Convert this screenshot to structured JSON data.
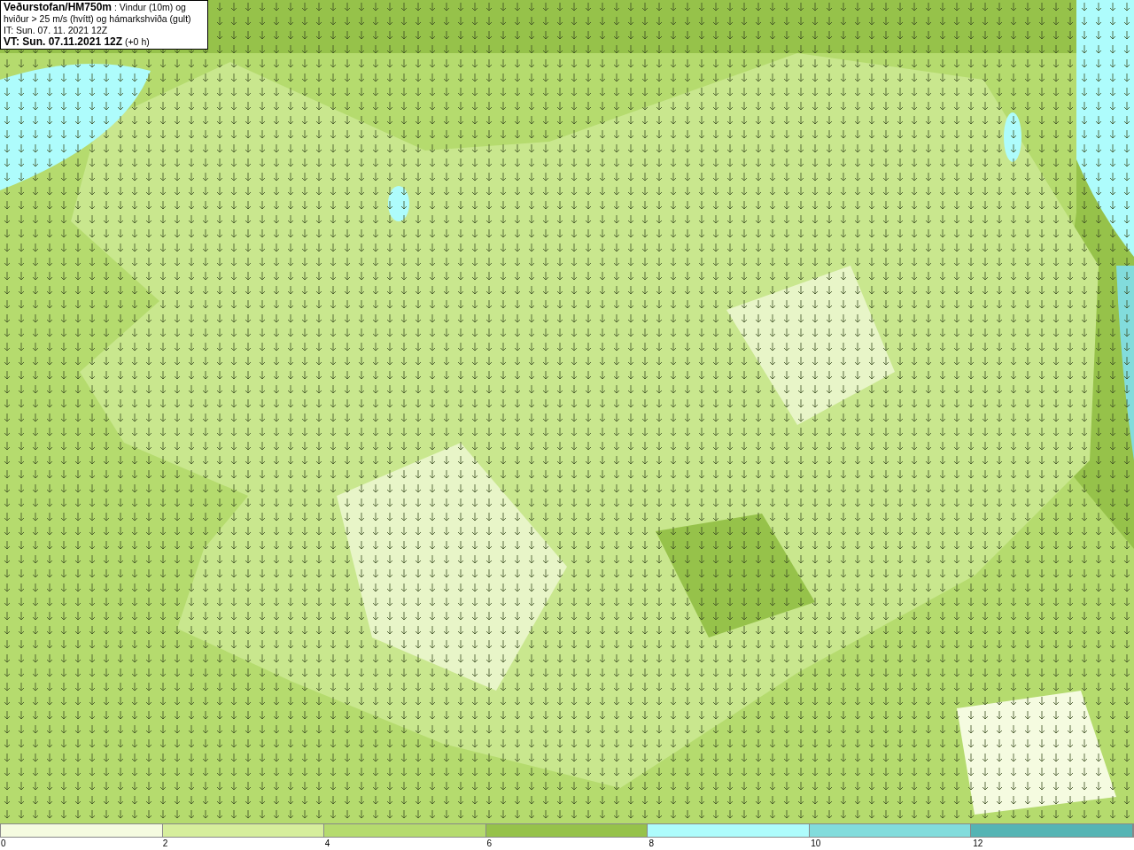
{
  "title_box": {
    "lines": [
      "**Veðurstofan/HM750m** : Vindur (10m) og",
      "hviður > 25 m/s (hvítt) og hámarkshviða (gult)",
      "IT: Sun. 07. 11. 2021 12Z",
      "**VT: Sun. 07.11.2021 12Z** (+0 h)"
    ]
  },
  "legend": {
    "bands": [
      {
        "color": "#f5fbe0"
      },
      {
        "color": "#d6ee9c"
      },
      {
        "color": "#b5db6e"
      },
      {
        "color": "#96c24a"
      },
      {
        "color": "#aefcfc"
      },
      {
        "color": "#82dcdc"
      },
      {
        "color": "#55b4b4"
      }
    ],
    "ticks": [
      "0",
      "2",
      "4",
      "6",
      "8",
      "10",
      "12"
    ]
  }
}
